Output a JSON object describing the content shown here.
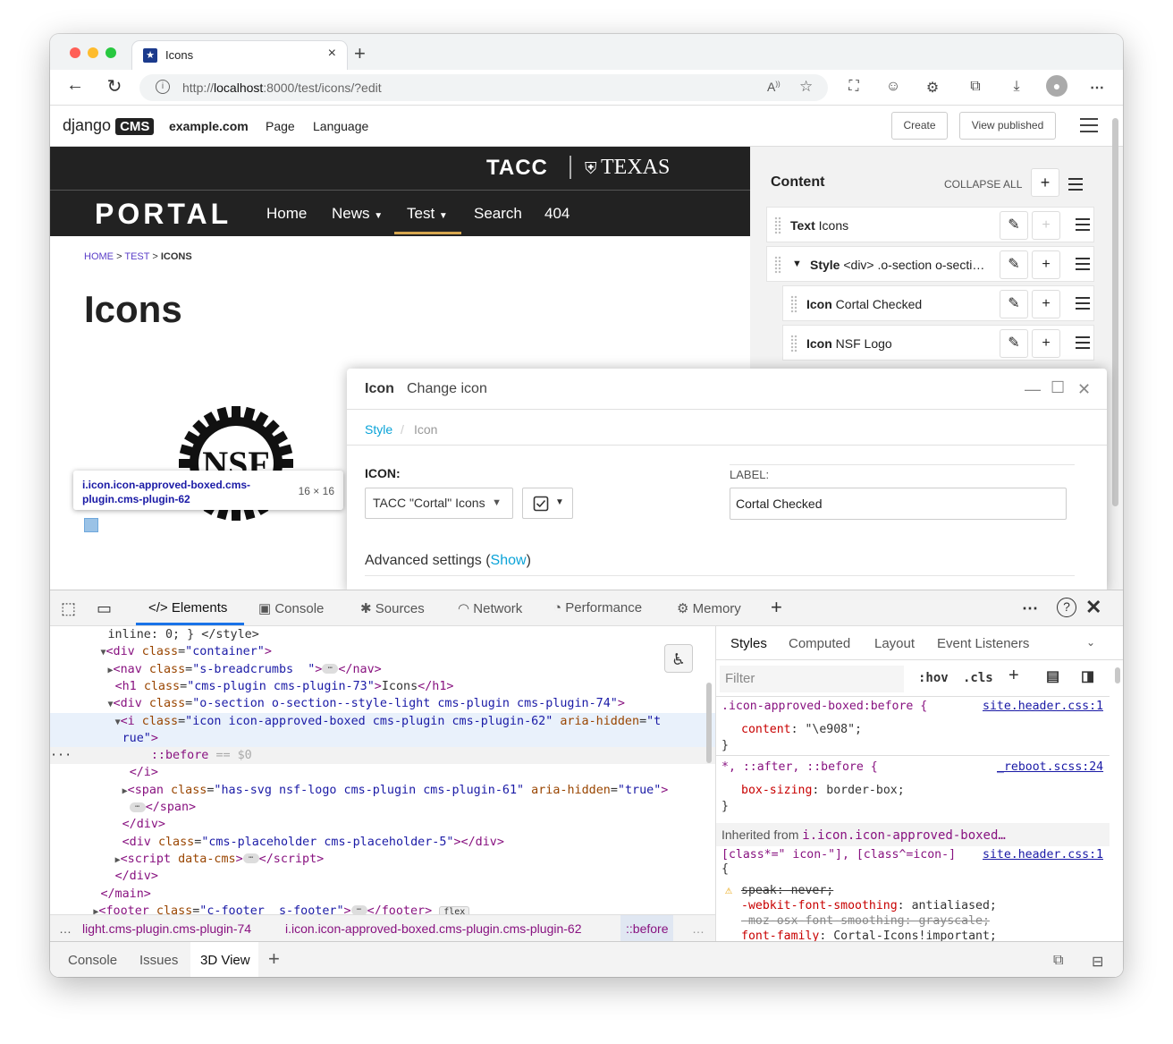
{
  "browser": {
    "tab_title": "Icons",
    "url_prefix": "http://",
    "url_host": "localhost",
    "url_rest": ":8000/test/icons/?edit"
  },
  "cms_toolbar": {
    "logo_text": "django",
    "logo_badge": "CMS",
    "site": "example.com",
    "page": "Page",
    "language": "Language",
    "create": "Create",
    "view_published": "View published"
  },
  "site_header": {
    "tacc": "TACC",
    "texas": "TEXAS",
    "portal": "PORTAL",
    "nav": [
      "Home",
      "News",
      "Test",
      "Search",
      "404"
    ]
  },
  "page": {
    "breadcrumbs": [
      "HOME",
      "TEST",
      "ICONS"
    ],
    "title": "Icons",
    "logo_text": "NSF"
  },
  "inspect_tooltip": {
    "selector": "i.icon.icon-approved-boxed.cms-plugin.cms-plugin-62",
    "size": "16 × 16"
  },
  "structure": {
    "heading": "Content",
    "collapse_all": "COLLAPSE ALL",
    "rows": [
      {
        "type": "Text",
        "name": "Icons"
      },
      {
        "type": "Style",
        "name": "<div> .o-section o-secti…"
      },
      {
        "type": "Icon",
        "name": "Cortal Checked"
      },
      {
        "type": "Icon",
        "name": "NSF Logo"
      }
    ]
  },
  "modal": {
    "title": "Icon",
    "subtitle": "Change icon",
    "breadcrumb_style": "Style",
    "breadcrumb_icon": "Icon",
    "icon_label": "ICON:",
    "icon_set": "TACC \"Cortal\" Icons",
    "label_label": "LABEL:",
    "label_value": "Cortal Checked",
    "advanced": "Advanced settings (",
    "show": "Show",
    "advanced_end": ")"
  },
  "devtools": {
    "tabs": [
      "Elements",
      "Console",
      "Sources",
      "Network",
      "Performance",
      "Memory"
    ],
    "code": {
      "l0": "inline: 0; } </style>",
      "l1_tag": "<div ",
      "l1_attr": "class",
      "l1_val": "\"container\"",
      "l2_attr": "class",
      "l2_val": "\"s-breadcrumbs  \"",
      "l3_val": "\"cms-plugin cms-plugin-73\"",
      "l3_text": "Icons",
      "l4_val": "\"o-section o-section--style-light cms-plugin cms-plugin-74\"",
      "l5_val": "\"icon icon-approved-boxed cms-plugin cms-plugin-62\"",
      "l5_attr2": "aria-hidden",
      "l5_val2": "\"t",
      "l6_val": "rue\"",
      "l7": "::before",
      "l7_eq": "== $0",
      "l9_val": "\"has-svg nsf-logo cms-plugin cms-plugin-61\"",
      "l9_val2": "\"true\"",
      "l12_val": "\"cms-placeholder cms-placeholder-5\"",
      "l13_attr": "data-cms",
      "l16_val": "\"c-footer  s-footer\"",
      "l16_badge": "flex"
    },
    "crumbs": [
      "light.cms-plugin.cms-plugin-74",
      "i.icon.icon-approved-boxed.cms-plugin.cms-plugin-62",
      "::before"
    ],
    "styles_tabs": [
      "Styles",
      "Computed",
      "Layout",
      "Event Listeners"
    ],
    "filter_placeholder": "Filter",
    "hov": ":hov",
    "cls": ".cls",
    "rule1_sel": ".icon-approved-boxed:before {",
    "rule1_src": "site.header.css:1",
    "rule1_prop": "content",
    "rule1_val": "\"\\e908\";",
    "rule2_sel": "*, ::after, ::before {",
    "rule2_src": "_reboot.scss:24",
    "rule2_prop": "box-sizing",
    "rule2_val": "border-box;",
    "inherited_label": "Inherited from ",
    "inherited_sel": "i.icon.icon-approved-boxed…",
    "rule3_sel": "[class*=\" icon-\"], [class^=icon-]",
    "rule3_src": "site.header.css:1",
    "rule3_p1": "speak: never;",
    "rule3_p2": "-webkit-font-smoothing",
    "rule3_v2": "antialiased;",
    "rule3_p3": "-moz-osx-font-smoothing: grayscale;",
    "rule3_p4": "font-family",
    "rule3_v4": "Cortal-Icons!important;",
    "drawer": [
      "Console",
      "Issues",
      "3D View"
    ]
  }
}
